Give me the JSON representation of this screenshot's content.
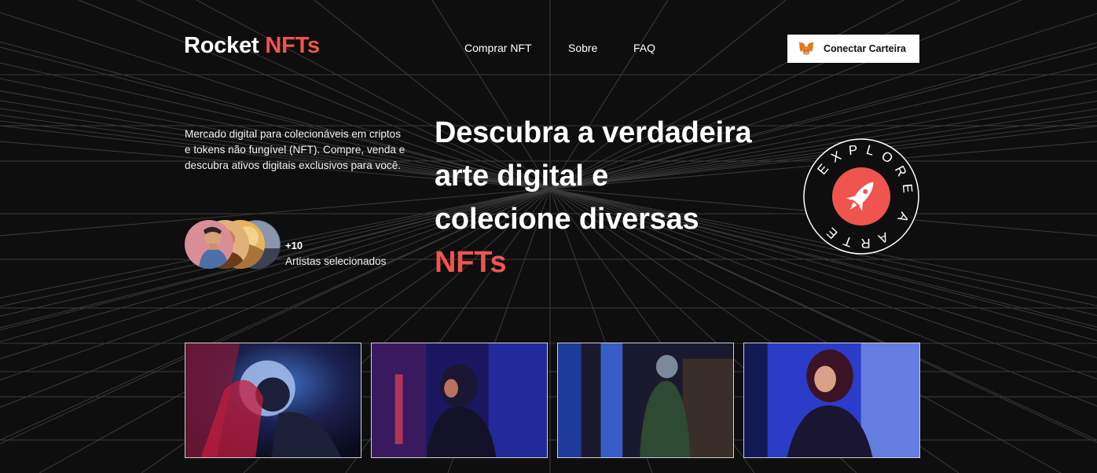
{
  "header": {
    "logo_main": "Rocket",
    "logo_accent": "NFTs",
    "nav": [
      "Comprar NFT",
      "Sobre",
      "FAQ"
    ],
    "wallet_button": "Conectar Carteira",
    "wallet_icon": "metamask-fox-icon"
  },
  "hero": {
    "intro": "Mercado digital para colecionáveis em criptos e tokens não fungível (NFT). Compre, venda e descubra ativos digitais exclusivos para você.",
    "artists_count": "+10",
    "artists_label": "Artistas selecionados",
    "headline_1": "Descubra a verdadeira",
    "headline_2": "arte digital e",
    "headline_3": "colecione diversas",
    "headline_accent": "NFTs",
    "badge_text": "EXPLORE A ARTE",
    "badge_icon": "rocket-icon"
  },
  "gallery": {
    "items": [
      "astronaut-photo-1",
      "astronaut-photo-2",
      "astronaut-photo-3",
      "astronaut-photo-4"
    ]
  },
  "colors": {
    "accent": "#f0544f",
    "background": "#0e0e0e",
    "text": "#ffffff"
  }
}
